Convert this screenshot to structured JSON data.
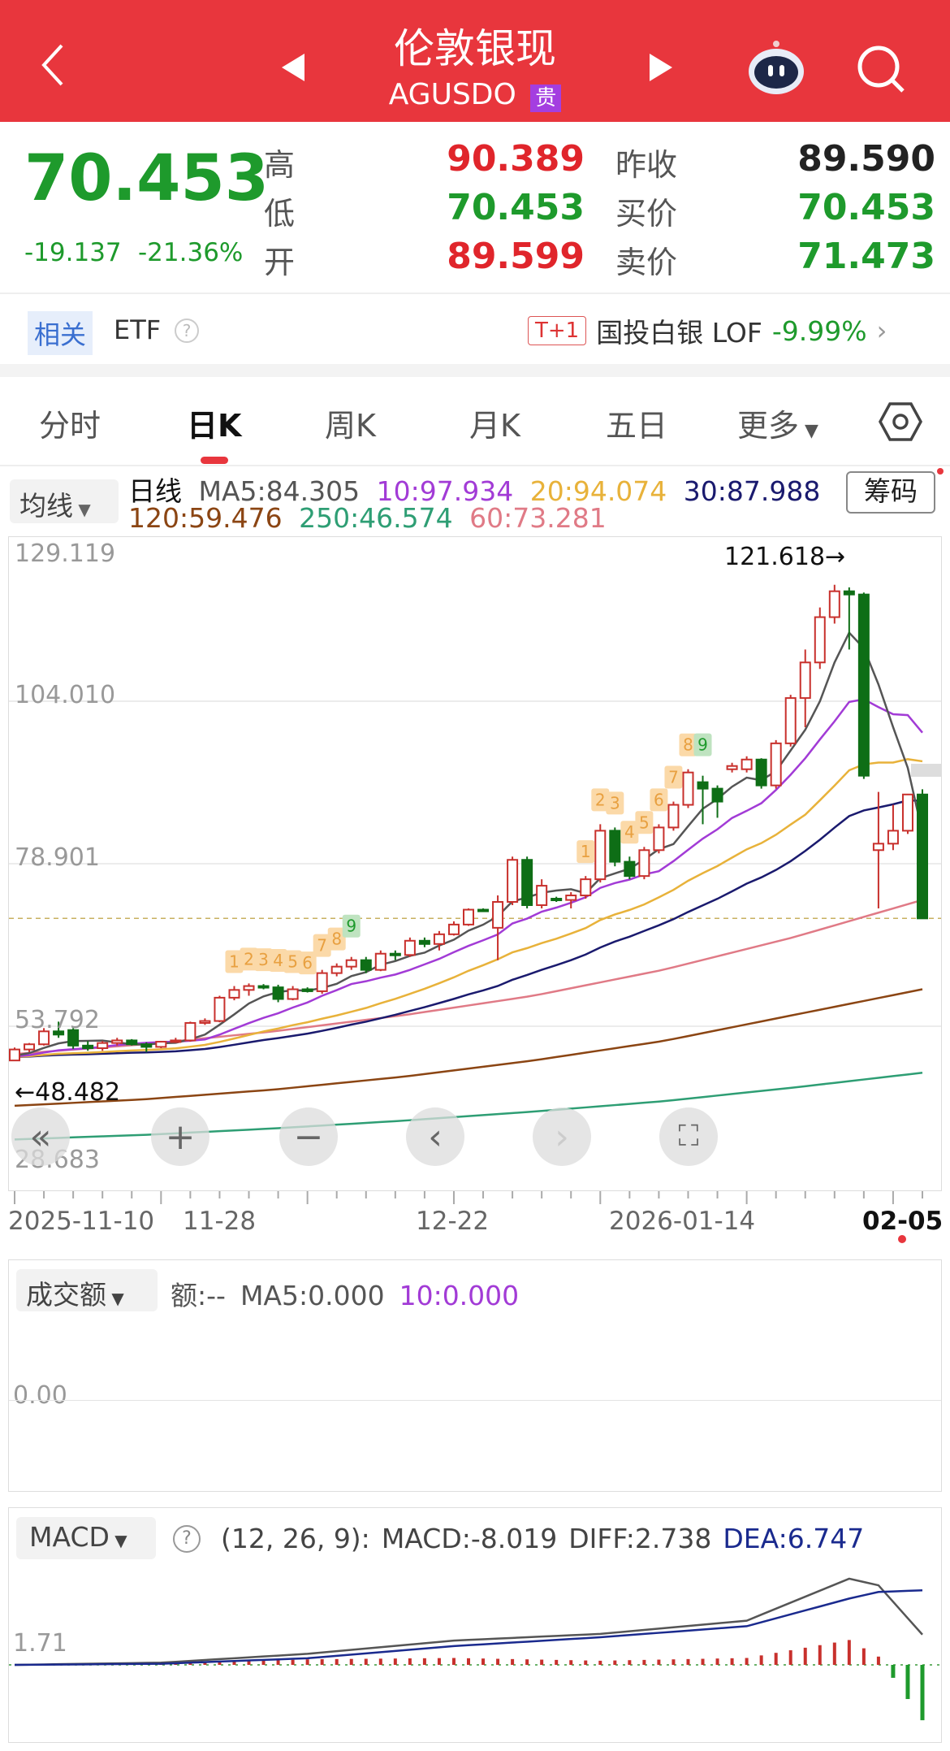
{
  "header": {
    "title": "伦敦银现",
    "code": "AGUSDO",
    "badge": "贵"
  },
  "quote": {
    "price": "70.453",
    "change": "-19.137",
    "change_pct": "-21.36%",
    "high_label": "高",
    "high": "90.389",
    "low_label": "低",
    "low": "70.453",
    "open_label": "开",
    "open": "89.599",
    "prev_close_label": "昨收",
    "prev_close": "89.590",
    "bid_label": "买价",
    "bid": "70.453",
    "ask_label": "卖价",
    "ask": "71.473"
  },
  "etf": {
    "chip": "相关",
    "label": "ETF",
    "help": "?",
    "tag": "T+1",
    "name": "国投白银 LOF",
    "change": "-9.99%"
  },
  "tabs": [
    "分时",
    "日K",
    "周K",
    "月K",
    "五日",
    "更多"
  ],
  "ma_legend": {
    "selector": "均线",
    "period": "日线",
    "ma5": "MA5:84.305",
    "ma10": "10:97.934",
    "ma20": "20:94.074",
    "ma30": "30:87.988",
    "ma120": "120:59.476",
    "ma250": "250:46.574",
    "ma60": "60:73.281",
    "chips_button": "筹码"
  },
  "colors": {
    "ma5": "#555555",
    "ma10": "#A23BD6",
    "ma20": "#E8B23A",
    "ma30": "#1A1A6E",
    "ma60": "#E07A86",
    "ma120": "#8B4513",
    "ma250": "#2E9E74",
    "up": "#C8302C",
    "down": "#0E6E16",
    "accent": "#E8363D"
  },
  "chart_data": {
    "type": "candlestick",
    "y_axis_labels": [
      "129.119",
      "104.010",
      "78.901",
      "53.792",
      "28.683"
    ],
    "ylim": [
      28.683,
      129.119
    ],
    "max_label": "121.618→",
    "min_label": "←48.482",
    "current_price": 70.453,
    "x_labels": [
      "2025-11-10",
      "11-28",
      "12-22",
      "2026-01-14",
      "02-05"
    ],
    "ohlc": [
      [
        48.5,
        50.5,
        48.5,
        50.2
      ],
      [
        50.2,
        51.2,
        49.8,
        51.0
      ],
      [
        51.0,
        53.5,
        50.8,
        53.0
      ],
      [
        53.0,
        54.5,
        52.0,
        52.5
      ],
      [
        53.2,
        53.5,
        50.3,
        50.8
      ],
      [
        50.8,
        51.5,
        50.0,
        50.4
      ],
      [
        50.4,
        51.5,
        50.0,
        51.2
      ],
      [
        51.2,
        52.0,
        50.8,
        51.6
      ],
      [
        51.6,
        51.8,
        50.8,
        51.0
      ],
      [
        51.0,
        51.3,
        49.8,
        50.6
      ],
      [
        50.6,
        51.5,
        50.4,
        51.4
      ],
      [
        51.4,
        52.0,
        51.2,
        51.6
      ],
      [
        51.6,
        54.5,
        51.4,
        54.3
      ],
      [
        54.3,
        55.0,
        54.0,
        54.6
      ],
      [
        54.6,
        58.5,
        54.4,
        58.2
      ],
      [
        58.2,
        60.0,
        57.8,
        59.4
      ],
      [
        59.4,
        60.4,
        58.5,
        60.0
      ],
      [
        60.0,
        60.3,
        59.5,
        59.8
      ],
      [
        59.8,
        60.2,
        57.5,
        58.0
      ],
      [
        58.0,
        60.0,
        57.8,
        59.5
      ],
      [
        59.5,
        59.8,
        59.0,
        59.2
      ],
      [
        59.2,
        62.5,
        58.8,
        62.0
      ],
      [
        62.0,
        63.5,
        61.5,
        63.0
      ],
      [
        63.0,
        64.5,
        62.5,
        64.0
      ],
      [
        64.0,
        64.5,
        62.0,
        62.5
      ],
      [
        62.5,
        65.5,
        62.3,
        65.0
      ],
      [
        65.0,
        65.5,
        64.0,
        64.8
      ],
      [
        64.8,
        67.5,
        64.5,
        67.0
      ],
      [
        67.0,
        67.5,
        66.0,
        66.5
      ],
      [
        66.5,
        68.5,
        65.5,
        68.0
      ],
      [
        68.0,
        70.0,
        67.8,
        69.5
      ],
      [
        69.5,
        72.0,
        69.3,
        71.8
      ],
      [
        71.8,
        72.0,
        71.5,
        71.6
      ],
      [
        69.0,
        74.0,
        64.0,
        73.0
      ],
      [
        73.0,
        80.0,
        72.5,
        79.5
      ],
      [
        79.5,
        80.0,
        72.0,
        72.5
      ],
      [
        72.5,
        76.5,
        72.0,
        75.5
      ],
      [
        73.5,
        73.8,
        73.0,
        73.3
      ],
      [
        73.3,
        74.5,
        72.0,
        74.0
      ],
      [
        74.0,
        77.0,
        73.5,
        76.5
      ],
      [
        76.5,
        85.0,
        76.0,
        84.0
      ],
      [
        84.0,
        84.5,
        78.5,
        79.2
      ],
      [
        79.2,
        80.0,
        76.5,
        77.0
      ],
      [
        77.0,
        81.5,
        76.5,
        81.0
      ],
      [
        81.0,
        85.0,
        80.5,
        84.5
      ],
      [
        84.5,
        88.5,
        84.0,
        88.0
      ],
      [
        88.0,
        93.5,
        87.5,
        93.0
      ],
      [
        91.5,
        92.5,
        85.0,
        90.5
      ],
      [
        90.5,
        91.0,
        86.0,
        88.5
      ],
      [
        93.5,
        94.5,
        93.0,
        94.0
      ],
      [
        93.5,
        95.5,
        93.0,
        95.0
      ],
      [
        95.0,
        95.2,
        90.5,
        91.0
      ],
      [
        91.0,
        98.0,
        90.5,
        97.5
      ],
      [
        97.5,
        105.0,
        97.0,
        104.5
      ],
      [
        104.5,
        112.0,
        100.0,
        110.0
      ],
      [
        110.0,
        118.5,
        109.0,
        117.0
      ],
      [
        117.0,
        122.0,
        116.0,
        121.0
      ],
      [
        121.0,
        121.6,
        112.0,
        120.5
      ],
      [
        120.5,
        120.8,
        92.0,
        92.5
      ],
      [
        81.0,
        90.0,
        72.0,
        82.0
      ],
      [
        82.0,
        88.0,
        81.0,
        84.0
      ],
      [
        84.0,
        89.5,
        83.5,
        89.6
      ],
      [
        89.6,
        90.4,
        70.45,
        70.45
      ]
    ],
    "ma60_samples": [
      49.5,
      51,
      53,
      55.5,
      58.5,
      62.5,
      67.5,
      73.3
    ],
    "ma120_samples": [
      41.5,
      42.5,
      44,
      46,
      48.5,
      51.5,
      55.5,
      59.5
    ],
    "ma250_samples": [
      36.3,
      37,
      38,
      39.2,
      40.6,
      42.2,
      44.3,
      46.6
    ],
    "td_markers": [
      [
        15,
        "1",
        "o"
      ],
      [
        16,
        "2",
        "o"
      ],
      [
        17,
        "3",
        "o"
      ],
      [
        18,
        "4",
        "o"
      ],
      [
        19,
        "5",
        "o"
      ],
      [
        20,
        "6",
        "o"
      ],
      [
        21,
        "7",
        "o"
      ],
      [
        22,
        "8",
        "o"
      ],
      [
        23,
        "9",
        "g"
      ],
      [
        39,
        "1",
        "o"
      ],
      [
        40,
        "2",
        "o"
      ],
      [
        41,
        "3",
        "o"
      ],
      [
        42,
        "4",
        "o"
      ],
      [
        43,
        "5",
        "o"
      ],
      [
        44,
        "6",
        "o"
      ],
      [
        45,
        "7",
        "o"
      ],
      [
        46,
        "8",
        "o"
      ],
      [
        47,
        "9",
        "g"
      ]
    ]
  },
  "volume": {
    "selector": "成交额",
    "amount": "额:--",
    "ma5": "MA5:0.000",
    "ma10": "10:0.000",
    "axis": "0.00"
  },
  "macd": {
    "selector": "MACD",
    "help": "?",
    "params": "(12, 26, 9):",
    "macd": "MACD:-8.019",
    "diff": "DIFF:2.738",
    "dea": "DEA:6.747",
    "axis": "1.71",
    "diff_keys": [
      [
        0,
        0
      ],
      [
        10,
        0.2
      ],
      [
        20,
        1.0
      ],
      [
        30,
        2.2
      ],
      [
        40,
        2.8
      ],
      [
        50,
        4.0
      ],
      [
        57,
        7.8
      ],
      [
        59,
        7.2
      ],
      [
        62,
        2.738
      ]
    ],
    "dea_keys": [
      [
        0,
        0
      ],
      [
        10,
        0.1
      ],
      [
        20,
        0.6
      ],
      [
        30,
        1.7
      ],
      [
        40,
        2.5
      ],
      [
        50,
        3.5
      ],
      [
        57,
        6.0
      ],
      [
        59,
        6.6
      ],
      [
        62,
        6.747
      ]
    ]
  }
}
